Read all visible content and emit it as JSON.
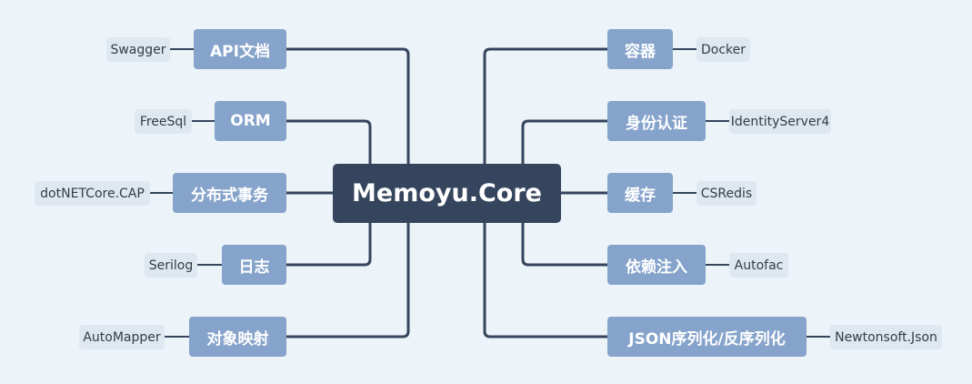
{
  "center": {
    "label": "Memoyu.Core"
  },
  "colors": {
    "background": "#ecf3f9",
    "center_fill": "#35455d",
    "branch_fill": "#86a3cb",
    "leaf_fill": "#dfe7f0",
    "line": "#35455d"
  },
  "left_branches": [
    {
      "label": "API文档",
      "leaf": "Swagger"
    },
    {
      "label": "ORM",
      "leaf": "FreeSql"
    },
    {
      "label": "分布式事务",
      "leaf": "dotNETCore.CAP"
    },
    {
      "label": "日志",
      "leaf": "Serilog"
    },
    {
      "label": "对象映射",
      "leaf": "AutoMapper"
    }
  ],
  "right_branches": [
    {
      "label": "容器",
      "leaf": "Docker"
    },
    {
      "label": "身份认证",
      "leaf": "IdentityServer4"
    },
    {
      "label": "缓存",
      "leaf": "CSRedis"
    },
    {
      "label": "依赖注入",
      "leaf": "Autofac"
    },
    {
      "label": "JSON序列化/反序列化",
      "leaf": "Newtonsoft.Json"
    }
  ]
}
